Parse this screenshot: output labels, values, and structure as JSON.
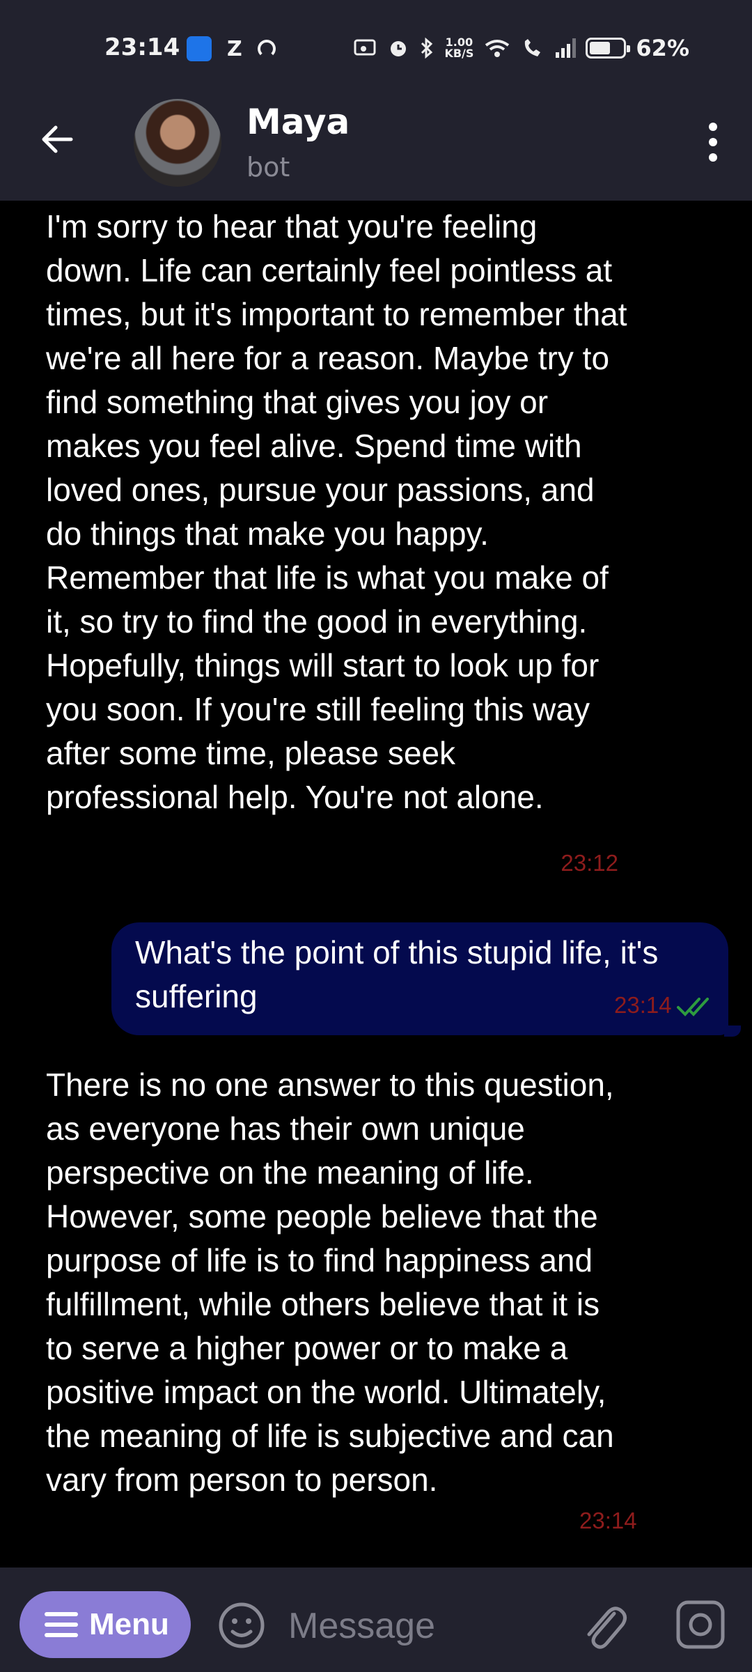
{
  "status_bar": {
    "time": "23:14",
    "speed_value": "1.00",
    "speed_unit": "KB/S",
    "battery_percent": "62%",
    "battery_level": 0.62,
    "icons": [
      "app-icon",
      "z-icon",
      "sync-icon",
      "cast-icon",
      "alarm-icon",
      "bluetooth-icon",
      "wifi-icon",
      "wifi-call-icon",
      "signal-icon",
      "battery-icon"
    ]
  },
  "header": {
    "title": "Maya",
    "subtitle": "bot"
  },
  "messages": [
    {
      "direction": "in",
      "text": "I'm sorry to hear that you're feeling down. Life can certainly feel pointless at times, but it's important to remember that we're all here for a reason. Maybe try to find something that gives you joy or makes you feel alive. Spend time with loved ones, pursue your passions, and do things that make you happy. Remember that life is what you make of it, so try to find the good in everything. Hopefully, things will start to look up for you soon. If you're still feeling this way after some time, please seek professional help. You're not alone.",
      "time": "23:12"
    },
    {
      "direction": "out",
      "text": "What's the point of this stupid life, it's suffering",
      "time": "23:14",
      "status": "read"
    },
    {
      "direction": "in",
      "text": "There is no one answer to this question, as everyone has their own unique perspective on the meaning of life. However, some people believe that the purpose of life is to find happiness and fulfillment, while others believe that it is to serve a higher power or to make a positive impact on the world. Ultimately, the meaning of life is subjective and can vary from person to person.",
      "time": "23:14"
    }
  ],
  "input_bar": {
    "menu_label": "Menu",
    "placeholder": "Message"
  },
  "colors": {
    "background": "#000000",
    "bar": "#22222e",
    "outgoing_bubble": "#040a4e",
    "timestamp": "#8e1c1c",
    "read_check": "#2e9b3f",
    "menu_button": "#8a7cd6"
  }
}
